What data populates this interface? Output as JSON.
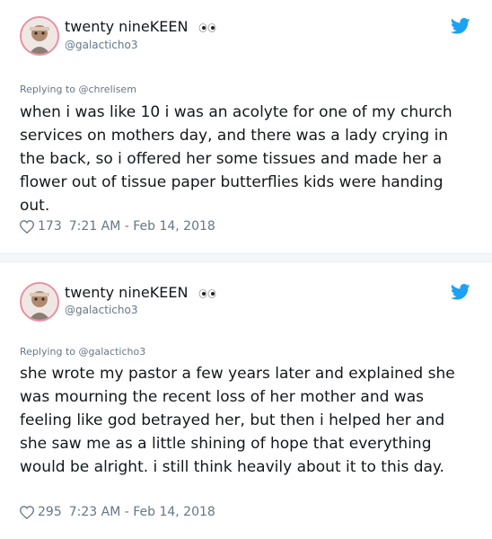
{
  "colors": {
    "text": "#14171a",
    "secondary": "#657786",
    "twitter_blue": "#1da1f2",
    "divider": "#f5f8fa"
  },
  "tweets": [
    {
      "display_name": "twenty nineKEEN",
      "handle": "@galacticho3",
      "reply_to": "Replying to @chrelisem",
      "body": "when i was like 10 i was an acolyte for one of my church services on mothers day, and there was a lady crying in the back, so i offered her some tissues and made her a flower out of tissue paper butterflies kids were handing out.",
      "likes": "173",
      "timestamp": "7:21 AM - Feb 14, 2018",
      "icons": [
        "avatar",
        "eyes-emoji-icon",
        "twitter-bird-icon",
        "heart-icon"
      ]
    },
    {
      "display_name": "twenty nineKEEN",
      "handle": "@galacticho3",
      "reply_to": "Replying to @galacticho3",
      "body": "she wrote my pastor a few years later and explained she was mourning the recent loss of her mother and was feeling like god betrayed her, but then i helped her and she saw me as a little shining of hope that everything would be alright. i still think heavily about it to this day.",
      "likes": "295",
      "timestamp": "7:23 AM - Feb 14, 2018",
      "icons": [
        "avatar",
        "eyes-emoji-icon",
        "twitter-bird-icon",
        "heart-icon"
      ]
    }
  ]
}
